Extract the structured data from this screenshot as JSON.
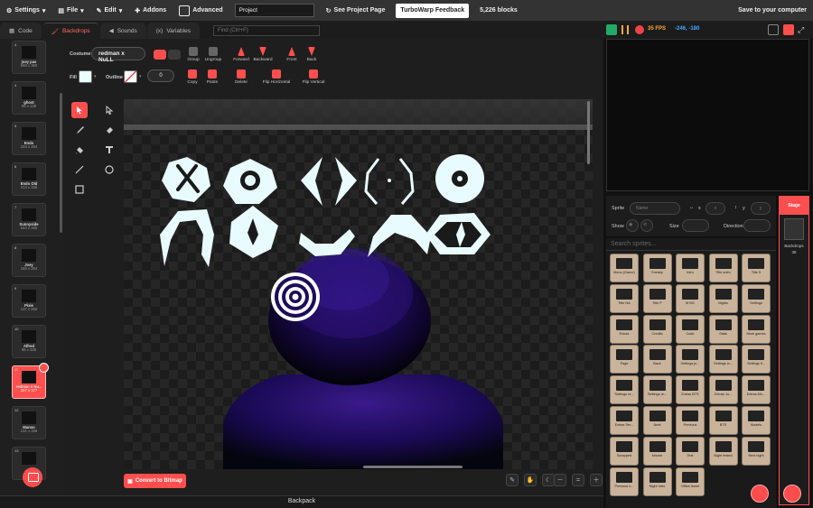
{
  "menubar": {
    "settings": "Settings",
    "file": "File",
    "edit": "Edit",
    "addons": "Addons",
    "advanced": "Advanced",
    "project_title": "Project",
    "see_project_page": "See Project Page",
    "turbowarp_feedback": "TurboWarp Feedback",
    "block_count": "5,226 blocks",
    "save": "Save to your computer"
  },
  "tabs": {
    "code": "Code",
    "backdrops": "Backdrops",
    "sounds": "Sounds",
    "variables": "Variables",
    "find_placeholder": "Find (Ctrl+F)"
  },
  "costumes": [
    {
      "num": "4",
      "name": "joey pas",
      "size": "588 x 360"
    },
    {
      "num": "4",
      "name": "ghost",
      "size": "96 x 139"
    },
    {
      "num": "5",
      "name": "Endo",
      "size": "153 x 264"
    },
    {
      "num": "6",
      "name": "Endo Old",
      "size": "413 x 336"
    },
    {
      "num": "7",
      "name": "Sunnyside",
      "size": "243 x 336"
    },
    {
      "num": "8",
      "name": "Joey",
      "size": "165 x 264"
    },
    {
      "num": "9",
      "name": "Pixie",
      "size": "137 x 260"
    },
    {
      "num": "10",
      "name": "Alfred",
      "size": "96 x 336"
    },
    {
      "num": "11",
      "name": "redman x Nu...",
      "size": "257 x 177"
    },
    {
      "num": "12",
      "name": "Manoo",
      "size": "131 x 336"
    },
    {
      "num": "13",
      "name": "",
      "size": ""
    }
  ],
  "paint": {
    "costume_label": "Costume",
    "costume_name": "redman x NuLL",
    "fill_label": "Fill",
    "outline_label": "Outline",
    "outline_width": "0",
    "group": "Group",
    "ungroup": "Ungroup",
    "forward": "Forward",
    "backward": "Backward",
    "front": "Front",
    "back": "Back",
    "copy": "Copy",
    "paste": "Paste",
    "delete": "Delete",
    "flip_h": "Flip Horizontal",
    "flip_v": "Flip Vertical",
    "convert": "Convert to Bitmap",
    "zoom_reset": "="
  },
  "backpack": "Backpack",
  "stage_bar": {
    "fps": "35 FPS",
    "coords": "-246, -180"
  },
  "sprite_info": {
    "sprite_label": "Sprite",
    "name_placeholder": "Name",
    "x_label": "x",
    "y_label": "y",
    "x_placeholder": "x",
    "y_placeholder": "y",
    "show_label": "Show",
    "size_label": "Size",
    "direction_label": "Direction"
  },
  "search_sprites_placeholder": "Search sprites...",
  "sprites": [
    "Menu (Game)",
    "Sneaky",
    "Intro",
    "Title anim",
    "Title 5",
    "Title NA",
    "Title P",
    "M BG",
    "Nights",
    "Settings",
    "Extras",
    "Credits",
    "Code",
    "Stats",
    "More games",
    "Page",
    "Back",
    "Settings ju...",
    "Settings lo...",
    "Settings fl...",
    "Settings re...",
    "Settings re...",
    "Extras BTS",
    "Extras Ju...",
    "Extras Mo...",
    "Extras Ser...",
    "Next",
    "Previous",
    "BTS",
    "Models",
    "Scrapped",
    "Mouse",
    "Text",
    "Night tested",
    "Next night",
    "Previous n...",
    "Night Intro",
    "Office Asset"
  ],
  "stage_panel": {
    "header": "Stage",
    "label": "Backdrops",
    "count": "38"
  },
  "colors": {
    "accent": "#ff4e4e",
    "fill": "#eaffff"
  }
}
